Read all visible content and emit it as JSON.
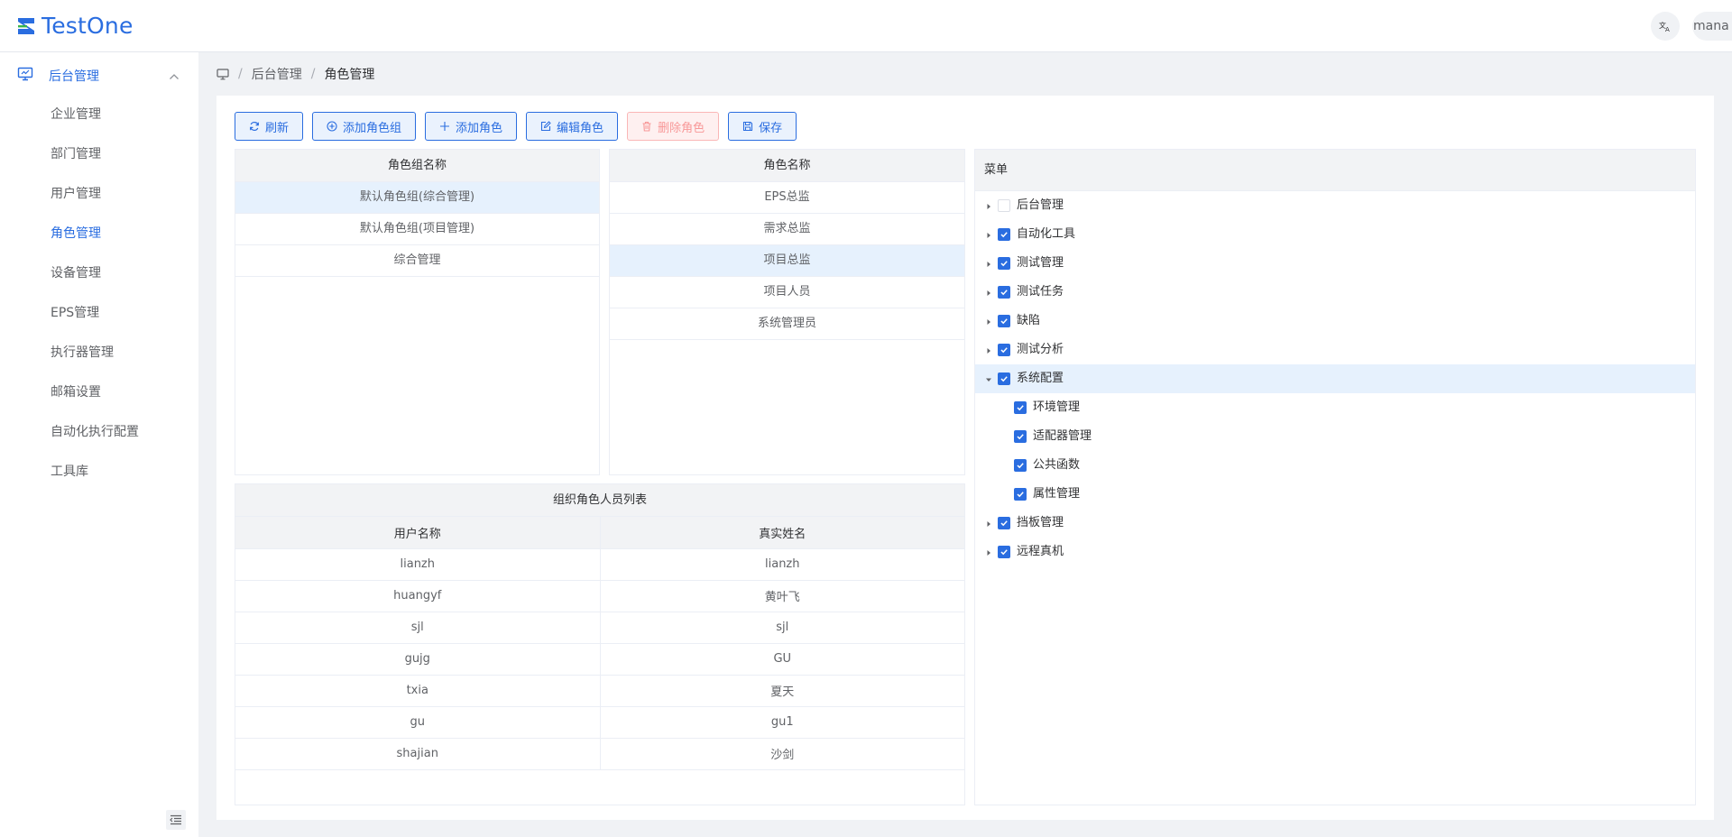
{
  "header": {
    "logo_text": "TestOne",
    "user_name": "mana",
    "colors": {
      "brand": "#2a6de0"
    }
  },
  "sidebar": {
    "group_label": "后台管理",
    "items": [
      {
        "label": "企业管理",
        "active": false
      },
      {
        "label": "部门管理",
        "active": false
      },
      {
        "label": "用户管理",
        "active": false
      },
      {
        "label": "角色管理",
        "active": true
      },
      {
        "label": "设备管理",
        "active": false
      },
      {
        "label": "EPS管理",
        "active": false
      },
      {
        "label": "执行器管理",
        "active": false
      },
      {
        "label": "邮箱设置",
        "active": false
      },
      {
        "label": "自动化执行配置",
        "active": false
      },
      {
        "label": "工具库",
        "active": false
      }
    ]
  },
  "breadcrumb": {
    "level1": "后台管理",
    "current": "角色管理"
  },
  "toolbar": {
    "refresh": "刷新",
    "add_group": "添加角色组",
    "add_role": "添加角色",
    "edit_role": "编辑角色",
    "delete_role": "删除角色",
    "save": "保存"
  },
  "role_groups": {
    "header": "角色组名称",
    "rows": [
      "默认角色组(综合管理)",
      "默认角色组(项目管理)",
      "综合管理"
    ],
    "selected": 0
  },
  "roles": {
    "header": "角色名称",
    "rows": [
      "EPS总监",
      "需求总监",
      "项目总监",
      "项目人员",
      "系统管理员"
    ],
    "selected": 2
  },
  "members": {
    "title": "组织角色人员列表",
    "columns": [
      "用户名称",
      "真实姓名"
    ],
    "rows": [
      [
        "lianzh",
        "lianzh"
      ],
      [
        "huangyf",
        "黄叶飞"
      ],
      [
        "sjl",
        "sjl"
      ],
      [
        "gujg",
        "GU"
      ],
      [
        "txia",
        "夏天"
      ],
      [
        "gu",
        "gu1"
      ],
      [
        "shajian",
        "沙剑"
      ]
    ]
  },
  "menu_tree": {
    "header": "菜单",
    "nodes": [
      {
        "label": "后台管理",
        "checked": false,
        "expanded": false,
        "level": 0
      },
      {
        "label": "自动化工具",
        "checked": true,
        "expanded": false,
        "level": 0
      },
      {
        "label": "测试管理",
        "checked": true,
        "expanded": false,
        "level": 0
      },
      {
        "label": "测试任务",
        "checked": true,
        "expanded": false,
        "level": 0
      },
      {
        "label": "缺陷",
        "checked": true,
        "expanded": false,
        "level": 0
      },
      {
        "label": "测试分析",
        "checked": true,
        "expanded": false,
        "level": 0
      },
      {
        "label": "系统配置",
        "checked": true,
        "expanded": true,
        "level": 0,
        "selected": true
      },
      {
        "label": "环境管理",
        "checked": true,
        "level": 1
      },
      {
        "label": "适配器管理",
        "checked": true,
        "level": 1
      },
      {
        "label": "公共函数",
        "checked": true,
        "level": 1
      },
      {
        "label": "属性管理",
        "checked": true,
        "level": 1
      },
      {
        "label": "挡板管理",
        "checked": true,
        "expanded": false,
        "level": 0
      },
      {
        "label": "远程真机",
        "checked": true,
        "expanded": false,
        "level": 0
      }
    ]
  }
}
